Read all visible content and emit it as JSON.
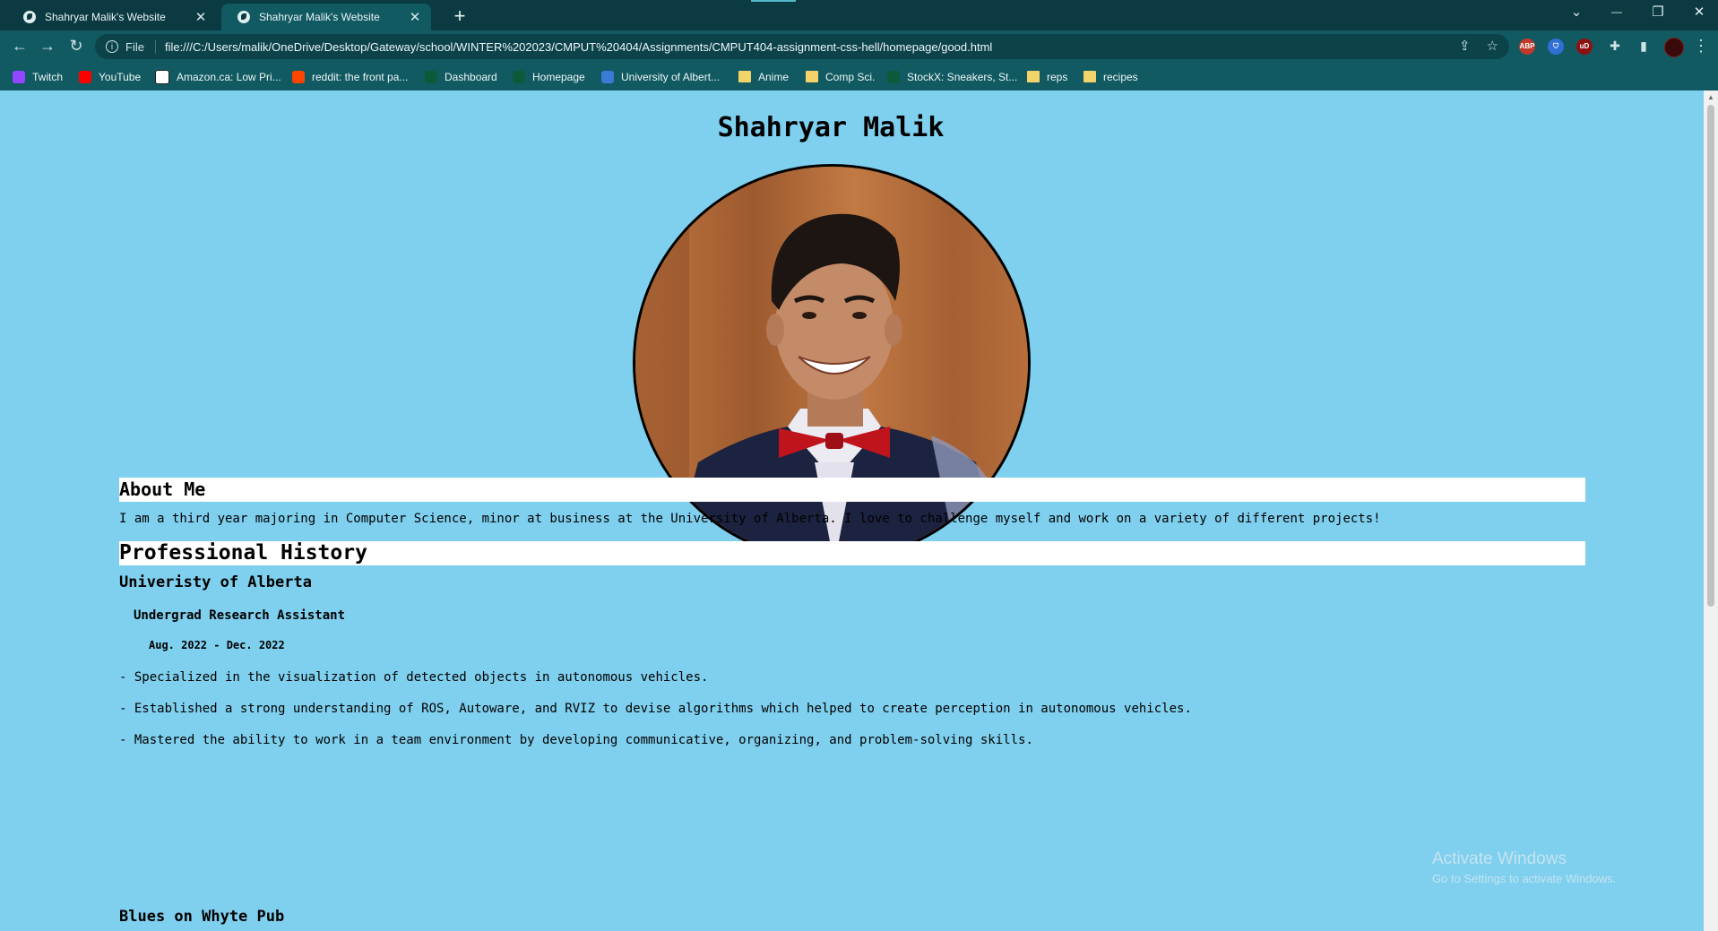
{
  "browser": {
    "tabs": [
      {
        "title": "Shahryar Malik's Website",
        "close": "✕"
      },
      {
        "title": "Shahryar Malik's Website",
        "close": "✕"
      }
    ],
    "new_tab": "+",
    "window_controls": {
      "tab_search": "⌄",
      "minimize": "—",
      "restore": "❐",
      "close": "✕"
    },
    "nav": {
      "back": "←",
      "forward": "→",
      "reload": "↻"
    },
    "omnibox": {
      "info": "i",
      "scheme": "File",
      "url": "file:///C:/Users/malik/OneDrive/Desktop/Gateway/school/WINTER%202023/CMPUT%20404/Assignments/CMPUT404-assignment-css-hell/homepage/good.html",
      "share": "⇪",
      "star": "☆"
    },
    "extensions": [
      {
        "name": "abp-icon",
        "label": "ABP",
        "color": "#c0392b"
      },
      {
        "name": "shield-icon",
        "label": "⛉",
        "color": "#2f6fd6"
      },
      {
        "name": "ublock-icon",
        "label": "uD",
        "color": "#8f1010"
      }
    ],
    "toolbar_icons": {
      "puzzle": "✚",
      "sidepanel": "▮",
      "menu": "⋮"
    },
    "bookmarks": [
      {
        "label": "Twitch",
        "icon": "twitch-icon",
        "color": "#9146ff"
      },
      {
        "label": "YouTube",
        "icon": "youtube-icon",
        "color": "#ff0000"
      },
      {
        "label": "Amazon.ca: Low Pri...",
        "icon": "amazon-icon",
        "color": "#ffffff"
      },
      {
        "label": "reddit: the front pa...",
        "icon": "reddit-icon",
        "color": "#ff4500"
      },
      {
        "label": "Dashboard",
        "icon": "dashboard-icon",
        "color": "#0d5a3a"
      },
      {
        "label": "Homepage",
        "icon": "homepage-icon",
        "color": "#0d5a3a"
      },
      {
        "label": "University of Albert...",
        "icon": "ualberta-icon",
        "color": "#3a7bd5"
      },
      {
        "label": "Anime",
        "icon": "folder-icon",
        "color": "#f3d46b"
      },
      {
        "label": "Comp Sci.",
        "icon": "folder-icon",
        "color": "#f3d46b"
      },
      {
        "label": "StockX: Sneakers, St...",
        "icon": "stockx-icon",
        "color": "#0d5a3a"
      },
      {
        "label": "reps",
        "icon": "folder-icon",
        "color": "#f3d46b"
      },
      {
        "label": "recipes",
        "icon": "folder-icon",
        "color": "#f3d46b"
      }
    ]
  },
  "page": {
    "name": "Shahryar Malik",
    "about_heading": "About Me",
    "about_text": "I am a third year majoring in Computer Science, minor at business at the University of Alberta. I love to challenge myself and work on a variety of different projects!",
    "history_heading": "Professional History",
    "jobs": [
      {
        "employer": "Univeristy of Alberta",
        "role": "Undergrad Research Assistant",
        "dates": "Aug. 2022 - Dec. 2022",
        "bullets": [
          "- Specialized in the visualization of detected objects in autonomous vehicles.",
          "- Established a strong understanding of ROS, Autoware, and RVIZ to devise algorithms which helped to create perception in autonomous vehicles.",
          "- Mastered the ability to work in a team environment by developing communicative, organizing, and problem-solving skills."
        ]
      },
      {
        "employer": "Blues on Whyte Pub"
      }
    ]
  },
  "os_watermark": {
    "title": "Activate Windows",
    "subtitle": "Go to Settings to activate Windows."
  },
  "colors": {
    "page_bg": "#7fcfee",
    "chrome_dark": "#0b3a42",
    "chrome": "#115a62",
    "banner": "#ffffff"
  }
}
